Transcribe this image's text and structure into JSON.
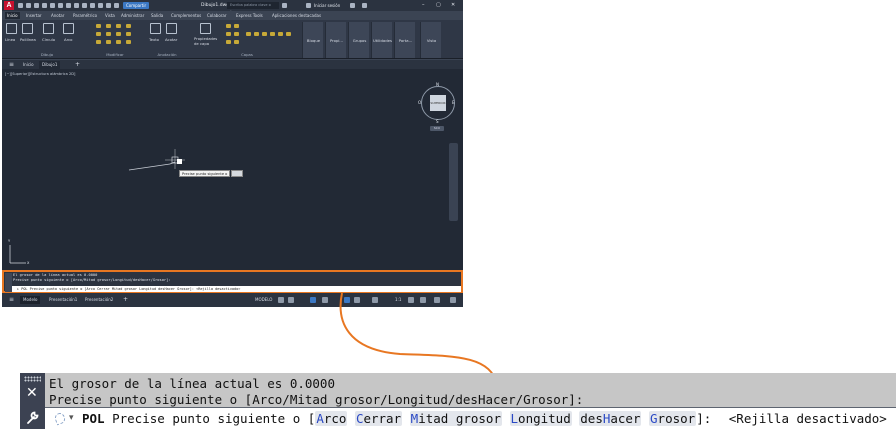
{
  "window": {
    "app_logo": "A",
    "share_label": "Compartir",
    "title": "Dibujo1.dwg",
    "search_placeholder": "Escriba palabra clave o frase",
    "signin_label": "Iniciar sesión",
    "win_controls": [
      "–",
      "▢",
      "✕"
    ]
  },
  "menubar": {
    "tabs": [
      "Inicio",
      "Insertar",
      "Anotar",
      "Paramétrico",
      "Vista",
      "Administrar",
      "Salida",
      "Complementos",
      "Colaborar",
      "Express Tools",
      "Aplicaciones destacadas"
    ],
    "active": "Inicio"
  },
  "ribbon": {
    "draw_tools": [
      "Línea",
      "Polilínea",
      "Círculo",
      "Arco"
    ],
    "text_tools": [
      "Texto",
      "Acotar"
    ],
    "layer_tool": "Propiedades de capa",
    "blocks": [
      "Bloque",
      "Propi...",
      "Grupos",
      "Utilidades",
      "Porta...",
      "Vista"
    ],
    "panels": [
      "Dibujo",
      "Modificar",
      "Anotación",
      "Capas"
    ]
  },
  "doctabs": {
    "home": "Inicio",
    "active": "Dibujo1",
    "add": "+"
  },
  "canvas": {
    "viewport_label": "[−][Superior][Estructura alámbrica 2D]",
    "viewcube_face": "SUPERIOR",
    "compass": {
      "n": "N",
      "s": "S",
      "e": "E",
      "w": "O"
    },
    "wcs_label": "SCU",
    "tooltip_text": "Precise punto siguiente o",
    "ucs_y": "Y",
    "ucs_x": "X"
  },
  "command_small": {
    "history": [
      "El grosor de la línea actual es 0.0000",
      "Precise punto siguiente o [Arco/Mitad grosor/Longitud/desHacer/Grosor]:"
    ],
    "input": "▸ POL Precise punto siguiente o [Arco Cerrar Mitad grosor Longitud desHacer Grosor]:   <Rejilla desactivado>"
  },
  "statusbar": {
    "tabs": [
      "Modelo",
      "Presentación1",
      "Presentación2",
      "+"
    ],
    "active": "Modelo",
    "mode_label": "MODELO",
    "scale_label": "1:1"
  },
  "command_zoom": {
    "history": [
      "El grosor de la línea actual es 0.0000",
      "Precise punto siguiente o [Arco/Mitad grosor/Longitud/desHacer/Grosor]:"
    ],
    "close_glyph": "✕",
    "dropdown_glyph": "▾",
    "cmd_name": "POL",
    "prompt": "Precise punto siguiente o [",
    "options": [
      {
        "hotkey": "A",
        "rest": "rco"
      },
      {
        "hotkey": "C",
        "rest": "errar"
      },
      {
        "hotkey": "M",
        "rest": "itad grosor"
      },
      {
        "hotkey": "L",
        "rest": "ongitud"
      },
      {
        "pre": "des",
        "hotkey": "H",
        "rest": "acer"
      },
      {
        "hotkey": "G",
        "rest": "rosor"
      }
    ],
    "prompt_end": "]:",
    "grid_status": "<Rejilla desactivado>"
  },
  "colors": {
    "highlight": "#e87722",
    "app_bg": "#222935",
    "history_bg": "#c6c6c6",
    "hotkey": "#2b49c4"
  }
}
